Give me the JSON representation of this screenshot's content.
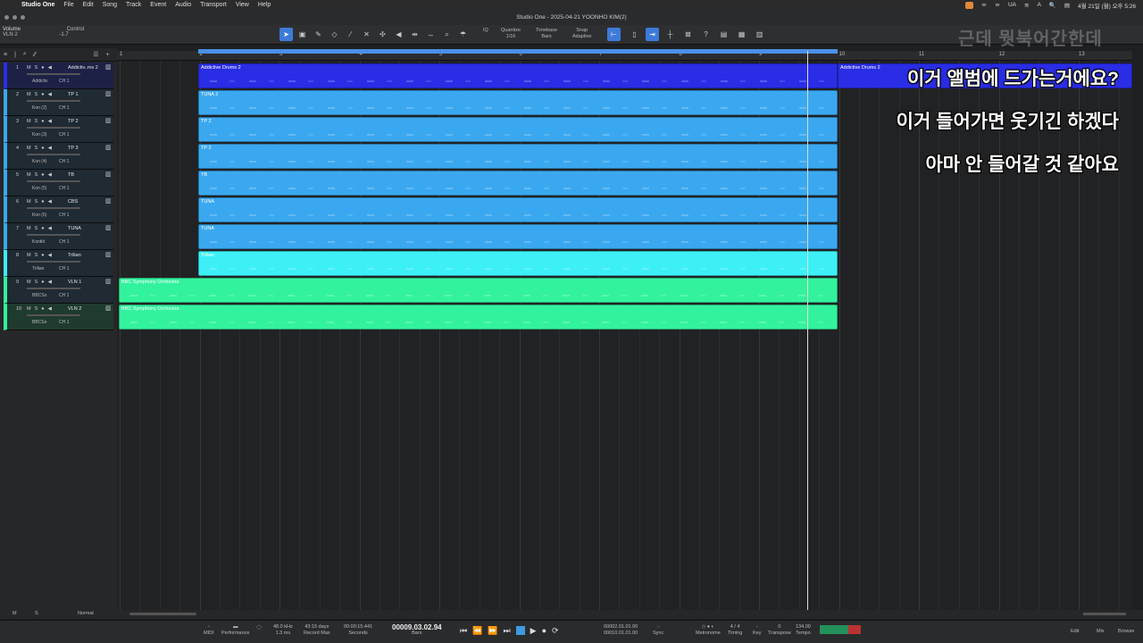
{
  "menubar": {
    "app": "Studio One",
    "items": [
      "File",
      "Edit",
      "Song",
      "Track",
      "Event",
      "Audio",
      "Transport",
      "View",
      "Help"
    ],
    "status": [
      "ᄒ",
      "ᄒ",
      "UA",
      "≡",
      "A",
      "🔍",
      "▤"
    ],
    "clock": "4월 21일 (월) 오후 5:26"
  },
  "window": {
    "title": "Studio One - 2025-04-21 YOONHO KIM(2)"
  },
  "toolbar": {
    "param_label": "Volume",
    "param_track": "VLN 2",
    "param_value": "-1.7",
    "control_label": "Control",
    "quantize_label": "Quantize",
    "quantize_value": "1/16",
    "timebase_label": "Timebase",
    "timebase_value": "Bars",
    "snap_label": "Snap",
    "snap_value": "Adaptive",
    "iq": "IQ"
  },
  "watermark": "근데 뭣북어간한데",
  "ruler": {
    "marks": [
      "1",
      "2",
      "3",
      "4",
      "5",
      "6",
      "7",
      "8",
      "9",
      "10",
      "11",
      "12",
      "13"
    ]
  },
  "tracks": [
    {
      "num": "1",
      "name": "Addictiv..ms 2",
      "inst": "Addictiv",
      "ch": "CH 1",
      "color": "#2a2de6",
      "clip": "Addictive Drums 2"
    },
    {
      "num": "2",
      "name": "TP 1",
      "inst": "Kon (2)",
      "ch": "CH 1",
      "color": "#3aa8f0",
      "clip": "TUNA 2"
    },
    {
      "num": "3",
      "name": "TP 2",
      "inst": "Kon (3)",
      "ch": "CH 1",
      "color": "#3aa8f0",
      "clip": "TP 2"
    },
    {
      "num": "4",
      "name": "TP 3",
      "inst": "Kon (4)",
      "ch": "CH 1",
      "color": "#3aa8f0",
      "clip": "TP 2"
    },
    {
      "num": "5",
      "name": "TB",
      "inst": "Kon (5)",
      "ch": "CH 1",
      "color": "#3aa8f0",
      "clip": "TB"
    },
    {
      "num": "6",
      "name": "CBS",
      "inst": "Kon (6)",
      "ch": "CH 1",
      "color": "#3aa8f0",
      "clip": "TUNA"
    },
    {
      "num": "7",
      "name": "TUNA",
      "inst": "Kontkt",
      "ch": "CH 1",
      "color": "#3aa8f0",
      "clip": "TUNA"
    },
    {
      "num": "8",
      "name": "Trilian",
      "inst": "Trilian",
      "ch": "CH 1",
      "color": "#3cf0f6",
      "clip": "Trilian"
    },
    {
      "num": "9",
      "name": "VLN 1",
      "inst": "BBCSo",
      "ch": "CH 1",
      "color": "#33f29e",
      "clip": "BBC Symphony Orchestra"
    },
    {
      "num": "10",
      "name": "VLN 2",
      "inst": "BBCSo",
      "ch": "CH 1",
      "color": "#33f29e",
      "clip": "BBC Symphony Orchestra"
    }
  ],
  "track_buttons": {
    "m": "M",
    "s": "S",
    "rec": "●",
    "mon": "◀"
  },
  "drums_tail": "Addictive Drums 2",
  "subtitles": [
    "이거 앨범에 드가는거에요?",
    "이거 들어가면 웃기긴 하겠다",
    "아마 안 들어갈 것 같아요"
  ],
  "bottom": {
    "m": "M",
    "s": "S",
    "mode": "Normal"
  },
  "transport": {
    "midi": "MIDI",
    "perf": "Performance",
    "rate": "48.0 kHz",
    "latency": "1.3 ms",
    "rec_max": "43:15 days",
    "rec_max_label": "Record Max",
    "seconds": "00:00:15.441",
    "seconds_label": "Seconds",
    "bars": "00009.03.02.94",
    "bars_label": "Bars",
    "loop_l": "00002.01.01.00",
    "loop_r": "00010.01.01.00",
    "sync": "Sync",
    "metronome": "Metronome",
    "timesig": "4 / 4",
    "timing": "Timing",
    "key": "Key",
    "transpose": "0",
    "transpose_label": "Transpose",
    "tempo": "134.00",
    "tempo_label": "Tempo",
    "edit": "Edit",
    "mix": "Mix",
    "browse": "Browse"
  }
}
